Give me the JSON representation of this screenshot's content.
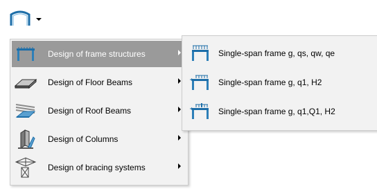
{
  "toolbar": {
    "icons": [
      "portal-frame-icon",
      "dropdown-arrow-icon"
    ],
    "accent": "#1d6ea8"
  },
  "menu": {
    "items": [
      {
        "label": "Design of frame structures",
        "icon": "frame-structure-icon",
        "active": true
      },
      {
        "label": "Design of Floor Beams",
        "icon": "floor-beam-icon",
        "active": false
      },
      {
        "label": "Design of Roof Beams",
        "icon": "roof-beam-icon",
        "active": false
      },
      {
        "label": "Design of Columns",
        "icon": "column-icon",
        "active": false
      },
      {
        "label": "Design of bracing systems",
        "icon": "bracing-icon",
        "active": false
      }
    ]
  },
  "submenu": {
    "items": [
      {
        "label": "Single-span frame g, qs, qw, qe",
        "icon": "frame-distributed-load-icon"
      },
      {
        "label": "Single-span frame g, q1, H2",
        "icon": "frame-horizontal-load-icon"
      },
      {
        "label": "Single-span frame g, q1,Q1, H2",
        "icon": "frame-point-load-icon"
      }
    ]
  },
  "colors": {
    "menu_bg": "#f2f2f2",
    "highlight_bg": "#9a9a9a",
    "icon_blue": "#1d6ea8"
  }
}
